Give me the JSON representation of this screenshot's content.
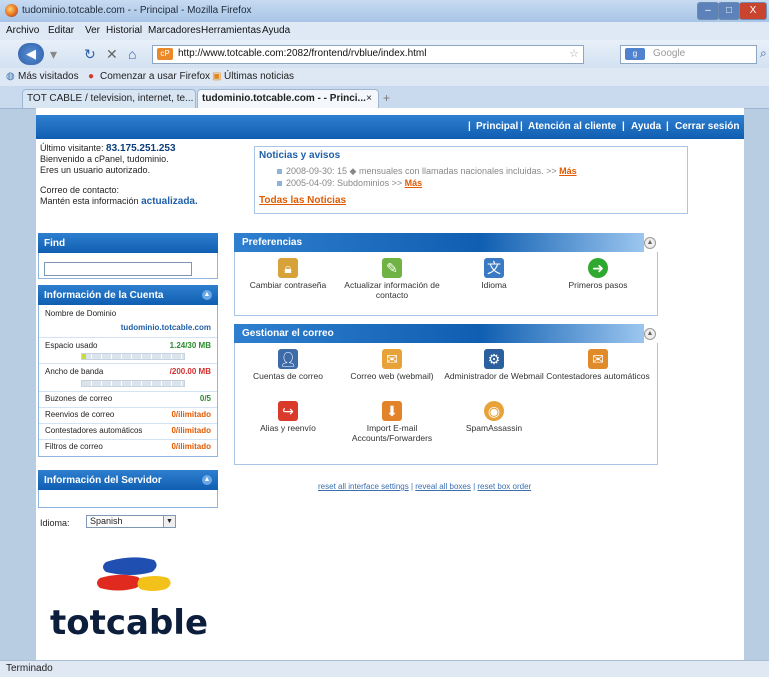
{
  "window": {
    "title": "tudominio.totcable.com - - Principal - Mozilla Firefox",
    "controls": [
      "–",
      "□",
      "X"
    ]
  },
  "menu": [
    "Archivo",
    "Editar",
    "Ver",
    "Historial",
    "Marcadores",
    "Herramientas",
    "Ayuda"
  ],
  "navbar": {
    "url": "http://www.totcable.com:2082/frontend/rvblue/index.html",
    "search_placeholder": "Google"
  },
  "bookmarks": [
    "Más visitados",
    "Comenzar a usar Firefox",
    "Últimas noticias"
  ],
  "tabs": [
    {
      "label": "TOT CABLE / television, internet, te...",
      "active": false
    },
    {
      "label": "tudominio.totcable.com - - Princi...",
      "active": true
    }
  ],
  "topnav": [
    "Principal",
    "Atención al cliente",
    "Ayuda",
    "Cerrar sesión"
  ],
  "greeting": {
    "last_visitor_label": "Último visitante:",
    "last_visitor_ip": "83.175.251.253",
    "line2": "Bienvenido a cPanel, tudominio.",
    "line3": "Eres un usuario autorizado.",
    "contact_label": "Correo de contacto:",
    "keep_info": "Mantén esta información",
    "updated": "actualizada."
  },
  "news": {
    "title": "Noticias y avisos",
    "items": [
      {
        "text": "2008-09-30: 15 ◆ mensuales con llamadas nacionales incluidas. >>",
        "more": "Más"
      },
      {
        "text": "2005-04-09: Subdominios >>",
        "more": "Más"
      }
    ],
    "all_link": "Todas las Noticias"
  },
  "sidebar": {
    "find_label": "Find",
    "account": {
      "title": "Información de la Cuenta",
      "domain_label": "Nombre de Dominio",
      "domain_value": "tudominio.totcable.com",
      "space_label": "Espacio usado",
      "space_value": "1.24/30 MB",
      "space_fill": 0.04,
      "bw_label": "Ancho de banda",
      "bw_value": "/200.00 MB",
      "bw_fill": 0,
      "rows": [
        {
          "label": "Buzones de correo",
          "value": "0/5"
        },
        {
          "label": "Reenvios de correo",
          "value": "0/ilimitado"
        },
        {
          "label": "Contestadores automáticos",
          "value": "0/ilimitado"
        },
        {
          "label": "Filtros de correo",
          "value": "0/ilimitado"
        }
      ]
    },
    "server_title": "Información del Servidor",
    "language_label": "Idioma:",
    "language_value": "Spanish"
  },
  "preferences": {
    "title": "Preferencias",
    "items": [
      {
        "label": "Cambiar contraseña",
        "icon": "lock-icon"
      },
      {
        "label": "Actualizar información de contacto",
        "icon": "contact-update-icon"
      },
      {
        "label": "Idioma",
        "icon": "language-icon"
      },
      {
        "label": "Primeros pasos",
        "icon": "getting-started-icon"
      }
    ]
  },
  "mail": {
    "title": "Gestionar el correo",
    "items": [
      {
        "label": "Cuentas de correo",
        "icon": "mail-accounts-icon"
      },
      {
        "label": "Correo web (webmail)",
        "icon": "webmail-icon"
      },
      {
        "label": "Administrador de Webmail",
        "icon": "webmail-admin-icon"
      },
      {
        "label": "Contestadores automáticos",
        "icon": "autoresponder-icon"
      },
      {
        "label": "Alias y reenvío",
        "icon": "forwarder-icon"
      },
      {
        "label": "Import E-mail Accounts/Forwarders",
        "icon": "import-icon"
      },
      {
        "label": "SpamAssassin",
        "icon": "spamassassin-icon"
      }
    ]
  },
  "resets": [
    "reset all interface settings",
    "reveal all boxes",
    "reset box order"
  ],
  "logo_text": "totcable",
  "status": "Terminado",
  "colors": {
    "brand_blue": "#0f5eb1",
    "accent_orange": "#e15a00",
    "value_green": "#2c8a2c",
    "value_red": "#d32f2f"
  }
}
